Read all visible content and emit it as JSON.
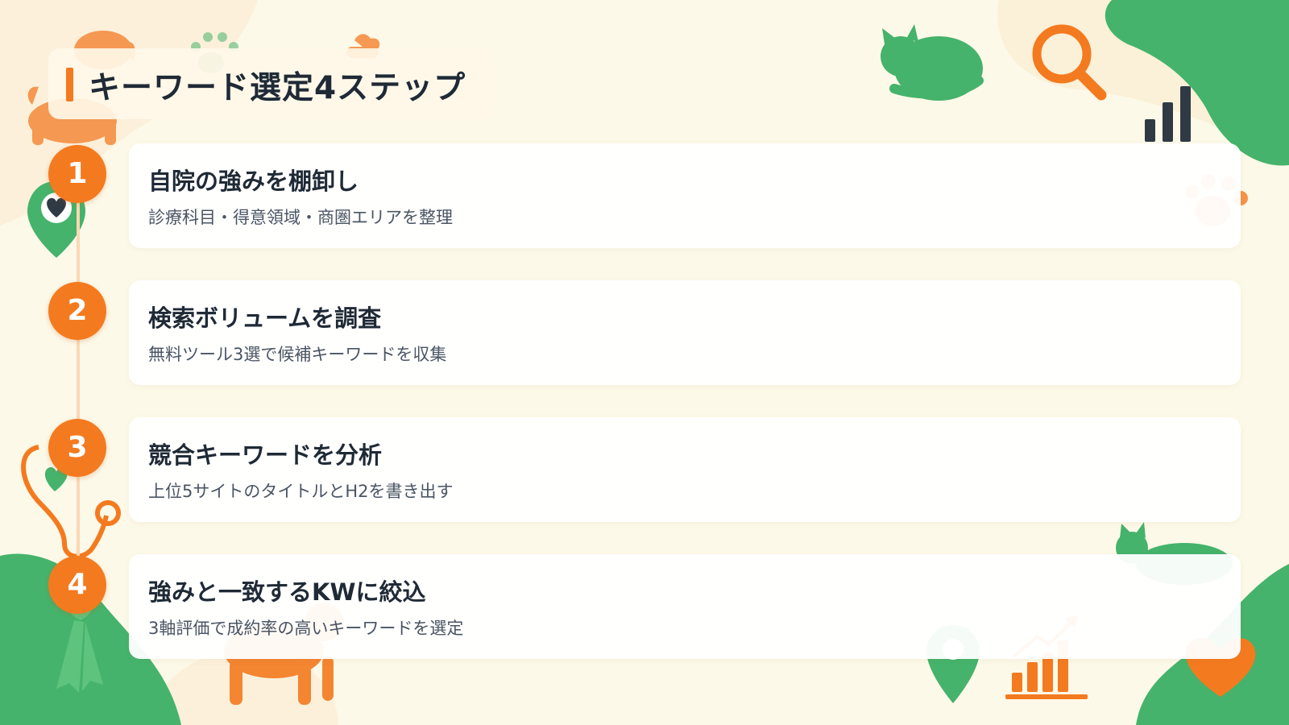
{
  "slide": {
    "title": "キーワード選定4ステップ"
  },
  "steps": [
    {
      "number": "1",
      "title": "自院の強みを棚卸し",
      "description": "診療科目・得意領域・商圏エリアを整理"
    },
    {
      "number": "2",
      "title": "検索ボリュームを調査",
      "description": "無料ツール3選で候補キーワードを収集"
    },
    {
      "number": "3",
      "title": "競合キーワードを分析",
      "description": "上位5サイトのタイトルとH2を書き出す"
    },
    {
      "number": "4",
      "title": "強みと一致するKWに絞込",
      "description": "3軸評価で成約率の高いキーワードを選定"
    }
  ],
  "colors": {
    "background": "#fdf9e8",
    "accent_orange": "#f47a1f",
    "accent_green": "#4cb86a",
    "text_dark": "#1f2a36",
    "text_muted": "#4a5563"
  },
  "decorations": [
    "dog-icon",
    "paw-print-icon",
    "cat-icon",
    "sleeping-cat-icon",
    "magnifier-icon",
    "bar-chart-icon",
    "location-pin-icon",
    "heart-icon",
    "stethoscope-icon",
    "ribbon-icon",
    "growth-chart-icon"
  ]
}
